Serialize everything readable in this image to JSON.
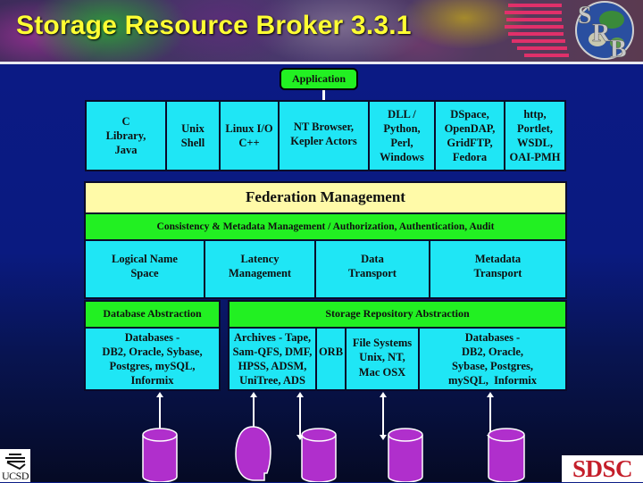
{
  "title": "Storage Resource Broker 3.3.1",
  "logo": {
    "letters": [
      "S",
      "R",
      "B"
    ],
    "icon": "srb-globe-logo"
  },
  "application": {
    "label": "Application"
  },
  "clients": [
    {
      "lines": [
        "C",
        "Library,",
        "Java"
      ]
    },
    {
      "lines": [
        "Unix",
        "Shell"
      ]
    },
    {
      "lines": [
        "Linux I/O",
        "C++"
      ]
    },
    {
      "lines": [
        "NT Browser,",
        "Kepler Actors"
      ]
    },
    {
      "lines": [
        "DLL /",
        "Python,",
        "Perl,",
        "Windows"
      ]
    },
    {
      "lines": [
        "DSpace,",
        "OpenDAP,",
        "GridFTP,",
        "Fedora"
      ]
    },
    {
      "lines": [
        "http,",
        "Portlet,",
        "WSDL,",
        "OAI-PMH"
      ]
    }
  ],
  "federation": {
    "label": "Federation Management"
  },
  "consistency": {
    "label": "Consistency  & Metadata Management / Authorization, Authentication, Audit"
  },
  "services": [
    {
      "lines": [
        "Logical Name",
        "Space"
      ]
    },
    {
      "lines": [
        "Latency",
        "Management"
      ]
    },
    {
      "lines": [
        "Data",
        "Transport"
      ]
    },
    {
      "lines": [
        "Metadata",
        "Transport"
      ]
    }
  ],
  "database_abstraction": {
    "label": "Database Abstraction",
    "content": [
      "Databases -",
      "DB2, Oracle, Sybase,",
      "Postgres, mySQL,",
      "Informix"
    ]
  },
  "storage_abstraction": {
    "label": "Storage Repository Abstraction",
    "cells": [
      {
        "lines": [
          "Archives - Tape,",
          "Sam-QFS, DMF,",
          "HPSS, ADSM,",
          "UniTree, ADS"
        ]
      },
      {
        "lines": [
          "ORB"
        ]
      },
      {
        "lines": [
          "File Systems",
          "Unix, NT,",
          "Mac OSX"
        ]
      },
      {
        "lines": [
          "Databases -",
          "DB2, Oracle,",
          "Sybase, Postgres,",
          "mySQL,  Informix"
        ]
      }
    ]
  },
  "storage_devices": [
    {
      "icon": "database-cylinder-icon"
    },
    {
      "icon": "tape-reel-icon"
    },
    {
      "icon": "database-cylinder-icon"
    },
    {
      "icon": "database-cylinder-icon"
    },
    {
      "icon": "database-cylinder-icon"
    }
  ],
  "footer": {
    "left_logo": "UCSD",
    "right_logo": "SDSC"
  },
  "colors": {
    "background": "#0b1c86",
    "title": "#ffff33",
    "cyan_box": "#1fe6f5",
    "green_box": "#22f022",
    "yellow_box": "#fffaa8",
    "storage_device": "#b02fcc",
    "sdsc_red": "#c41e2a"
  }
}
